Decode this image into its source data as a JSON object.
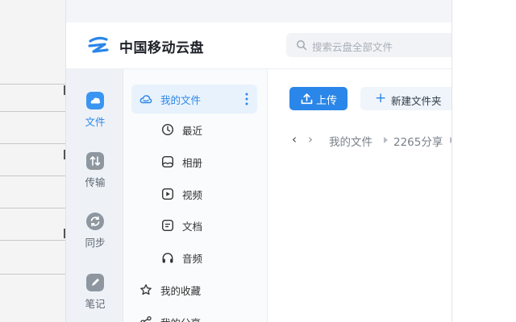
{
  "app": {
    "title": "中国移动云盘"
  },
  "search": {
    "placeholder": "搜索云盘全部文件"
  },
  "rail": {
    "items": [
      {
        "label": "文件",
        "icon": "cloud-icon",
        "active": true
      },
      {
        "label": "传输",
        "icon": "transfer-icon"
      },
      {
        "label": "同步",
        "icon": "sync-icon"
      },
      {
        "label": "笔记",
        "icon": "note-icon"
      }
    ]
  },
  "nav": {
    "items": [
      {
        "label": "我的文件",
        "icon": "cloud-outline-icon",
        "active": true
      },
      {
        "label": "最近",
        "icon": "clock-icon"
      },
      {
        "label": "相册",
        "icon": "album-icon"
      },
      {
        "label": "视频",
        "icon": "video-icon"
      },
      {
        "label": "文档",
        "icon": "document-icon"
      },
      {
        "label": "音频",
        "icon": "headphones-icon"
      },
      {
        "label": "我的收藏",
        "icon": "star-icon"
      },
      {
        "label": "我的分享",
        "icon": "share-icon"
      }
    ]
  },
  "toolbar": {
    "upload_label": "上传",
    "new_folder_label": "新建文件夹"
  },
  "breadcrumb": {
    "items": [
      "我的文件",
      "2265分享"
    ]
  },
  "colors": {
    "accent": "#2a86e8",
    "rail_bg": "#eef2f7"
  }
}
